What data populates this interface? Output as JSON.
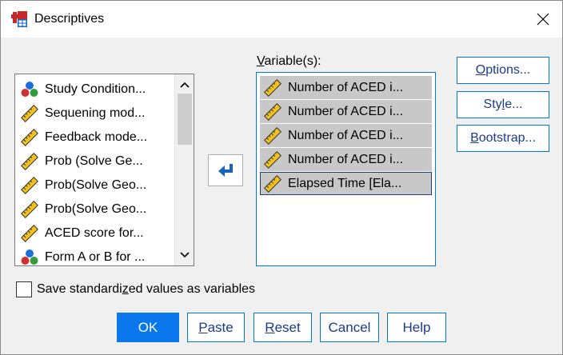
{
  "window": {
    "title": "Descriptives"
  },
  "source_list": {
    "items": [
      {
        "label": "Study Condition...",
        "icon": "nominal-icon"
      },
      {
        "label": "Sequening mod...",
        "icon": "scale-icon"
      },
      {
        "label": "Feedback mode...",
        "icon": "scale-icon"
      },
      {
        "label": "Prob (Solve Ge...",
        "icon": "scale-icon"
      },
      {
        "label": "Prob(Solve Geo...",
        "icon": "scale-icon"
      },
      {
        "label": "Prob(Solve Geo...",
        "icon": "scale-icon"
      },
      {
        "label": "ACED score for...",
        "icon": "scale-icon"
      },
      {
        "label": "Form A or B for ...",
        "icon": "nominal-icon"
      }
    ]
  },
  "variables": {
    "label_prefix": "",
    "label_hotkey": "V",
    "label_rest": "ariable(s):",
    "items": [
      {
        "label": "Number of ACED i..."
      },
      {
        "label": "Number of ACED i..."
      },
      {
        "label": "Number of ACED i..."
      },
      {
        "label": "Number of ACED i..."
      },
      {
        "label": "Elapsed Time [Ela..."
      }
    ]
  },
  "side_buttons": {
    "options": {
      "pre": "",
      "hot": "O",
      "post": "ptions..."
    },
    "style": {
      "pre": "Sty",
      "hot": "l",
      "post": "e..."
    },
    "bootstrap": {
      "pre": "",
      "hot": "B",
      "post": "ootstrap..."
    }
  },
  "checkbox": {
    "pre": "Save standardi",
    "hot": "z",
    "post": "ed values as variables",
    "checked": false
  },
  "buttons": {
    "ok": "OK",
    "paste": {
      "pre": "",
      "hot": "P",
      "post": "aste"
    },
    "reset": {
      "pre": "",
      "hot": "R",
      "post": "eset"
    },
    "cancel": "Cancel",
    "help": "Help"
  },
  "colors": {
    "accent": "#0078d7",
    "primary_button": "#0a78ec",
    "selection": "#c8c8c8",
    "ruler_yellow": "#f2c21a"
  }
}
